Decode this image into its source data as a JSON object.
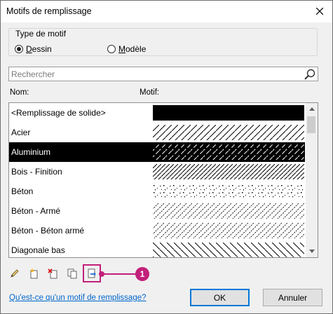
{
  "window": {
    "title": "Motifs de remplissage"
  },
  "pattern_type": {
    "legend": "Type de motif",
    "options": [
      {
        "label": "Dessin",
        "mnemonic": "D",
        "rest": "essin",
        "selected": true
      },
      {
        "label": "Modèle",
        "mnemonic": "M",
        "rest": "odèle",
        "selected": false
      }
    ]
  },
  "search": {
    "placeholder": "Rechercher",
    "value": ""
  },
  "columns": {
    "name": "Nom:",
    "pattern": "Motif:"
  },
  "patterns": [
    {
      "name": "<Remplissage de solide>",
      "fill": "solid",
      "selected": false
    },
    {
      "name": "Acier",
      "fill": "diagonal",
      "selected": false
    },
    {
      "name": "Aluminium",
      "fill": "diagonal-dashed",
      "selected": true
    },
    {
      "name": "Bois - Finition",
      "fill": "diagonal-dense",
      "selected": false
    },
    {
      "name": "Béton",
      "fill": "speckle",
      "selected": false
    },
    {
      "name": "Béton - Armé",
      "fill": "diagonal-speckle",
      "selected": false
    },
    {
      "name": "Béton - Béton armé",
      "fill": "diagonal-speckle",
      "selected": false
    },
    {
      "name": "Diagonale bas",
      "fill": "diagonal-down",
      "selected": false
    }
  ],
  "toolbar": [
    "edit-icon",
    "new-icon",
    "delete-icon",
    "duplicate-icon",
    "export-icon"
  ],
  "callout": {
    "number": "1",
    "color": "#c2207a"
  },
  "help_link": "Qu'est-ce qu'un motif de remplissage?",
  "buttons": {
    "ok": "OK",
    "cancel": "Annuler"
  }
}
